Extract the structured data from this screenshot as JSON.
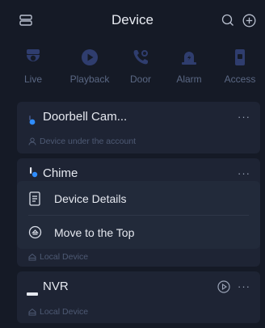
{
  "header": {
    "title": "Device"
  },
  "tabs": [
    {
      "label": "Live",
      "icon": "camera-icon"
    },
    {
      "label": "Playback",
      "icon": "playback-icon"
    },
    {
      "label": "Door",
      "icon": "door-icon"
    },
    {
      "label": "Alarm",
      "icon": "alarm-icon"
    },
    {
      "label": "Access",
      "icon": "access-icon"
    }
  ],
  "devices": [
    {
      "name": "Doorbell Cam...",
      "subtitle": "Device under the account",
      "more": "···"
    },
    {
      "name": "Chime",
      "more": "···"
    },
    {
      "subtitle": "Local Device"
    },
    {
      "name": "NVR",
      "subtitle": "Local Device",
      "more": "···"
    }
  ],
  "context_menu": {
    "items": [
      {
        "label": "Device Details"
      },
      {
        "label": "Move to the Top"
      }
    ]
  },
  "colors": {
    "accent": "#2f8dff",
    "muted_tab": "#2b3a6b",
    "background": "#151a26",
    "card": "#1e2434"
  }
}
